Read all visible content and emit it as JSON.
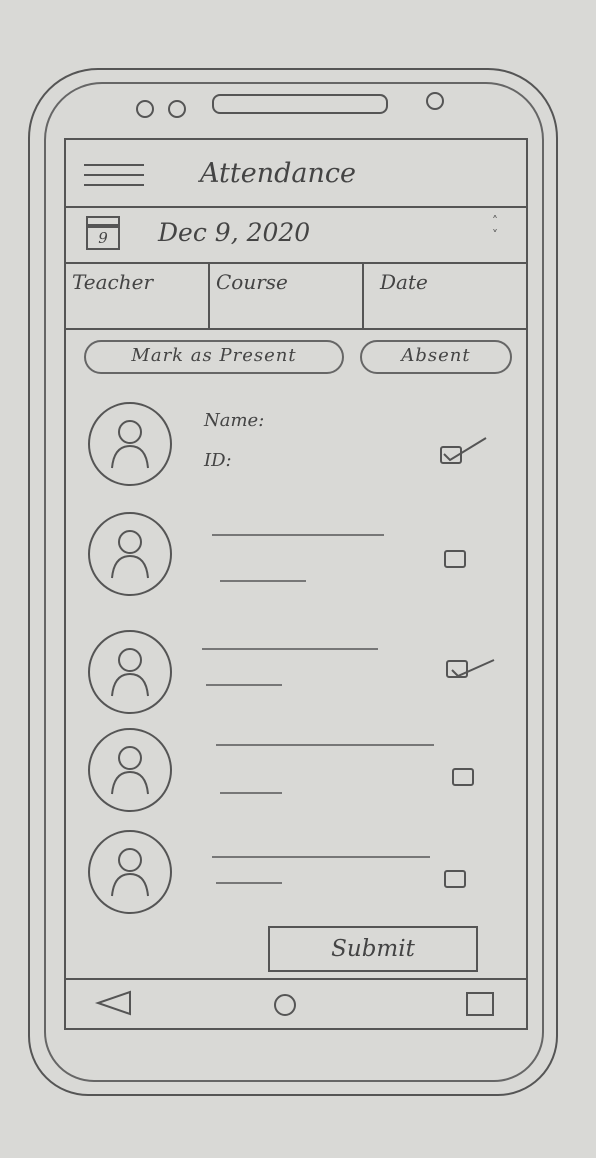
{
  "app": {
    "title": "Attendance"
  },
  "date_bar": {
    "day_number": "9",
    "date": "Dec 9, 2020",
    "stepper_up": "˄",
    "stepper_down": "˅"
  },
  "tabs": [
    {
      "label": "Teacher"
    },
    {
      "label": "Course"
    },
    {
      "label": "Date"
    }
  ],
  "actions": {
    "mark_present": "Mark as Present",
    "absent": "Absent"
  },
  "students": [
    {
      "name_label": "Name:",
      "id_label": "ID:",
      "checked": true
    },
    {
      "name_label": "",
      "id_label": "",
      "checked": false
    },
    {
      "name_label": "",
      "id_label": "",
      "checked": true
    },
    {
      "name_label": "",
      "id_label": "",
      "checked": false
    },
    {
      "name_label": "",
      "id_label": "",
      "checked": false
    }
  ],
  "submit_label": "Submit"
}
